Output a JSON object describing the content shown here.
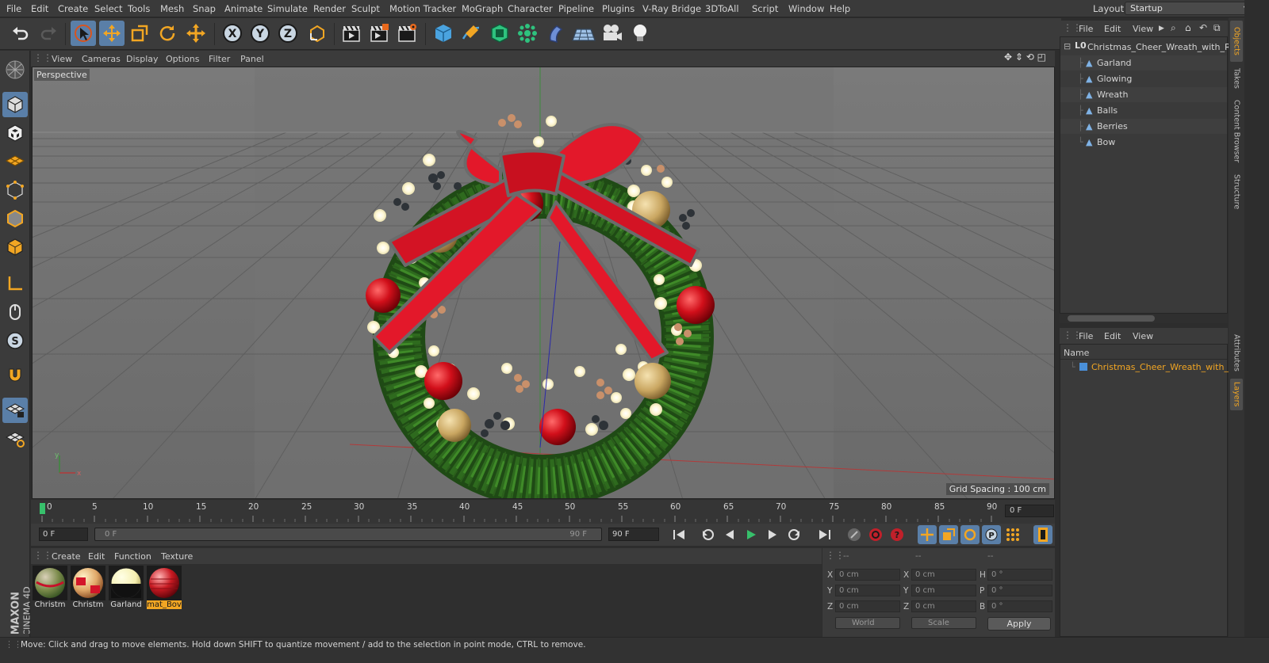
{
  "menubar": {
    "items": [
      "File",
      "Edit",
      "Create",
      "Select",
      "Tools",
      "Mesh",
      "Snap",
      "Animate",
      "Simulate",
      "Render",
      "Sculpt",
      "Motion Tracker",
      "MoGraph",
      "Character",
      "Pipeline",
      "Plugins",
      "V-Ray Bridge",
      "3DToAll",
      "Script",
      "Window",
      "Help"
    ],
    "layout_label": "Layout:",
    "layout_value": "Startup"
  },
  "viewport": {
    "menu": [
      "View",
      "Cameras",
      "Display",
      "Options",
      "Filter",
      "Panel"
    ],
    "camera_label": "Perspective",
    "grid_spacing": "Grid Spacing : 100 cm"
  },
  "timeline": {
    "ticks": [
      "0",
      "5",
      "10",
      "15",
      "20",
      "25",
      "30",
      "35",
      "40",
      "45",
      "50",
      "55",
      "60",
      "65",
      "70",
      "75",
      "80",
      "85",
      "90"
    ],
    "current_frame": "0 F",
    "start_field": "0 F",
    "range_start": "0 F",
    "range_end": "90 F",
    "end_field": "90 F"
  },
  "materials": {
    "menu": [
      "Create",
      "Edit",
      "Function",
      "Texture"
    ],
    "items": [
      {
        "label": "Christm"
      },
      {
        "label": "Christm"
      },
      {
        "label": "Garland"
      },
      {
        "label": "mat_Bov"
      }
    ]
  },
  "coordinates": {
    "header": [
      "--",
      "--",
      "--"
    ],
    "rows": [
      {
        "a": "X",
        "av": "0 cm",
        "b": "X",
        "bv": "0 cm",
        "c": "H",
        "cv": "0 °"
      },
      {
        "a": "Y",
        "av": "0 cm",
        "b": "Y",
        "bv": "0 cm",
        "c": "P",
        "cv": "0 °"
      },
      {
        "a": "Z",
        "av": "0 cm",
        "b": "Z",
        "bv": "0 cm",
        "c": "B",
        "cv": "0 °"
      }
    ],
    "mode_world": "World",
    "mode_scale": "Scale",
    "apply": "Apply"
  },
  "objects": {
    "menu": [
      "File",
      "Edit",
      "View"
    ],
    "root": "Christmas_Cheer_Wreath_with_Red",
    "children": [
      "Garland",
      "Glowing",
      "Wreath",
      "Balls",
      "Berries",
      "Bow"
    ]
  },
  "layers": {
    "menu": [
      "File",
      "Edit",
      "View"
    ],
    "column": "Name",
    "item": "Christmas_Cheer_Wreath_with_Red"
  },
  "vtabs": [
    "Objects",
    "Takes",
    "Content Browser",
    "Structure",
    "Attributes",
    "Layers"
  ],
  "brand": {
    "maxon": "MAXON",
    "product": "CINEMA 4D"
  },
  "status": "Move: Click and drag to move elements. Hold down SHIFT to quantize movement / add to the selection in point mode, CTRL to remove."
}
